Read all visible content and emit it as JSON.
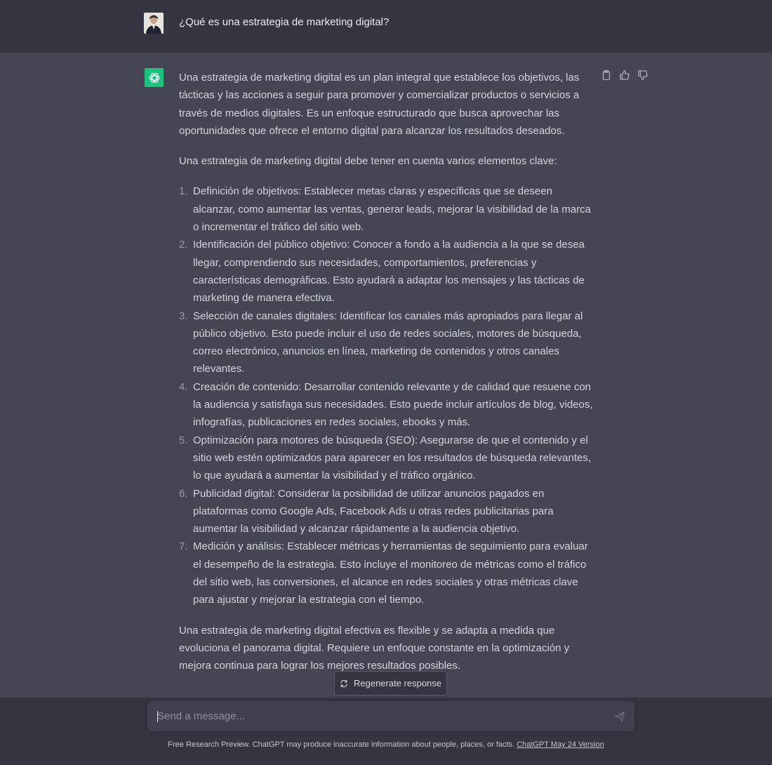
{
  "user": {
    "avatar": "user-photo-avatar",
    "message": "¿Qué es una estrategia de marketing digital?"
  },
  "assistant": {
    "avatar": "openai-logo-icon",
    "actions": [
      "clipboard-icon",
      "thumbs-up-icon",
      "thumbs-down-icon"
    ],
    "intro": "Una estrategia de marketing digital es un plan integral que establece los objetivos, las tácticas y las acciones a seguir para promover y comercializar productos o servicios a través de medios digitales. Es un enfoque estructurado que busca aprovechar las oportunidades que ofrece el entorno digital para alcanzar los resultados deseados.",
    "lead": "Una estrategia de marketing digital debe tener en cuenta varios elementos clave:",
    "items": [
      {
        "num": "1.",
        "text": "Definición de objetivos: Establecer metas claras y específicas que se deseen alcanzar, como aumentar las ventas, generar leads, mejorar la visibilidad de la marca o incrementar el tráfico del sitio web."
      },
      {
        "num": "2.",
        "text": "Identificación del público objetivo: Conocer a fondo a la audiencia a la que se desea llegar, comprendiendo sus necesidades, comportamientos, preferencias y características demográficas. Esto ayudará a adaptar los mensajes y las tácticas de marketing de manera efectiva."
      },
      {
        "num": "3.",
        "text": "Selección de canales digitales: Identificar los canales más apropiados para llegar al público objetivo. Esto puede incluir el uso de redes sociales, motores de búsqueda, correo electrónico, anuncios en línea, marketing de contenidos y otros canales relevantes."
      },
      {
        "num": "4.",
        "text": "Creación de contenido: Desarrollar contenido relevante y de calidad que resuene con la audiencia y satisfaga sus necesidades. Esto puede incluir artículos de blog, videos, infografías, publicaciones en redes sociales, ebooks y más."
      },
      {
        "num": "5.",
        "text": "Optimización para motores de búsqueda (SEO): Asegurarse de que el contenido y el sitio web estén optimizados para aparecer en los resultados de búsqueda relevantes, lo que ayudará a aumentar la visibilidad y el tráfico orgánico."
      },
      {
        "num": "6.",
        "text": "Publicidad digital: Considerar la posibilidad de utilizar anuncios pagados en plataformas como Google Ads, Facebook Ads u otras redes publicitarias para aumentar la visibilidad y alcanzar rápidamente a la audiencia objetivo."
      },
      {
        "num": "7.",
        "text": "Medición y análisis: Establecer métricas y herramientas de seguimiento para evaluar el desempeño de la estrategia. Esto incluye el monitoreo de métricas como el tráfico del sitio web, las conversiones, el alcance en redes sociales y otras métricas clave para ajustar y mejorar la estrategia con el tiempo."
      }
    ],
    "closing": "Una estrategia de marketing digital efectiva es flexible y se adapta a medida que evoluciona el panorama digital. Requiere un enfoque constante en la optimización y mejora continua para lograr los mejores resultados posibles."
  },
  "regenerate": {
    "icon": "refresh-icon",
    "label": "Regenerate response"
  },
  "composer": {
    "placeholder": "Send a message...",
    "value": "",
    "send_icon": "send-icon"
  },
  "footer": {
    "text": "Free Research Preview. ChatGPT may produce inaccurate information about people, places, or facts. ",
    "link": "ChatGPT May 24 Version"
  },
  "colors": {
    "page_bg": "#343541",
    "assistant_bg": "#444654",
    "accent_green": "#19c37d"
  }
}
